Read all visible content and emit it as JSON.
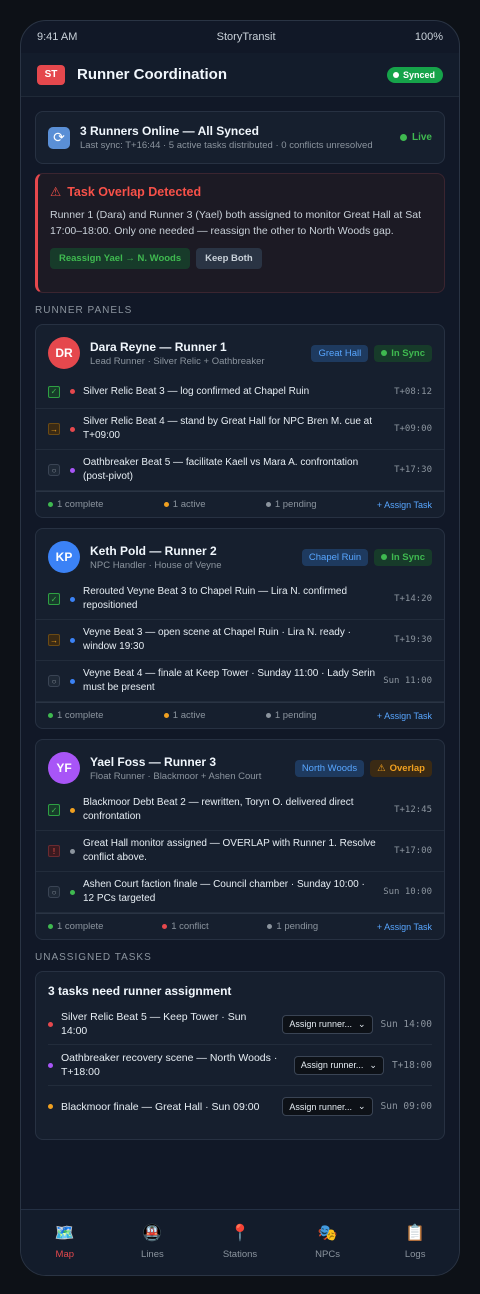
{
  "status_bar": {
    "time": "9:41 AM",
    "carrier": "StoryTransit",
    "battery": "100%"
  },
  "header": {
    "logo": "ST",
    "title": "Runner Coordination",
    "badge": "Synced"
  },
  "sync": {
    "icon": "sync-icon",
    "title": "3 Runners Online — All Synced",
    "subtitle": "Last sync: T+16:44 · 5 active tasks distributed · 0 conflicts unresolved",
    "live": "Live"
  },
  "alert": {
    "icon": "warning-icon",
    "title": "Task Overlap Detected",
    "body": "Runner 1 (Dara) and Runner 3 (Yael) both assigned to monitor Great Hall at Sat 17:00–18:00. Only one needed — reassign the other to North Woods gap.",
    "primary": "Reassign Yael → N. Woods",
    "secondary": "Keep Both"
  },
  "sections": {
    "runners": "RUNNER PANELS",
    "unassigned": "UNASSIGNED TASKS"
  },
  "colors": {
    "accent": "#e5484d",
    "green": "#3fb950",
    "amber": "#f0a020",
    "blue": "#58a6ff",
    "purple": "#a855f7",
    "gray": "#8b949e"
  },
  "runners": [
    {
      "initials": "DR",
      "avatar_color": "#e5484d",
      "name": "Dara Reyne — Runner 1",
      "role": "Lead Runner · Silver Relic + Oathbreaker",
      "location": "Great Hall",
      "state": "In Sync",
      "tasks": [
        {
          "status": "done",
          "dot": "#e5484d",
          "text": "Silver Relic Beat 3 — log confirmed at Chapel Ruin",
          "time": "T+08:12"
        },
        {
          "status": "active",
          "dot": "#e5484d",
          "text": "Silver Relic Beat 4 — stand by Great Hall for NPC Bren M. cue at T+09:00",
          "time": "T+09:00"
        },
        {
          "status": "pending",
          "dot": "#a855f7",
          "text": "Oathbreaker Beat 5 — facilitate Kaell vs Mara A. confrontation (post-pivot)",
          "time": "T+17:30"
        }
      ],
      "footer": {
        "a": "1 complete",
        "b": "1 active",
        "c": "1 pending",
        "link": "+ Assign Task"
      }
    },
    {
      "initials": "KP",
      "avatar_color": "#3b82f6",
      "name": "Keth Pold — Runner 2",
      "role": "NPC Handler · House of Veyne",
      "location": "Chapel Ruin",
      "state": "In Sync",
      "tasks": [
        {
          "status": "done",
          "dot": "#3b82f6",
          "text": "Rerouted Veyne Beat 3 to Chapel Ruin — Lira N. confirmed repositioned",
          "time": "T+14:20"
        },
        {
          "status": "active",
          "dot": "#3b82f6",
          "text": "Veyne Beat 3 — open scene at Chapel Ruin · Lira N. ready · window 19:30",
          "time": "T+19:30"
        },
        {
          "status": "pending",
          "dot": "#3b82f6",
          "text": "Veyne Beat 4 — finale at Keep Tower · Sunday 11:00 · Lady Serin must be present",
          "time": "Sun 11:00"
        }
      ],
      "footer": {
        "a": "1 complete",
        "b": "1 active",
        "c": "1 pending",
        "link": "+ Assign Task"
      }
    },
    {
      "initials": "YF",
      "avatar_color": "#a855f7",
      "name": "Yael Foss — Runner 3",
      "role": "Float Runner · Blackmoor + Ashen Court",
      "location": "North Woods",
      "state": "Overlap",
      "tasks": [
        {
          "status": "done",
          "dot": "#f0a020",
          "text": "Blackmoor Debt Beat 2 — rewritten, Toryn O. delivered direct confrontation",
          "time": "T+12:45"
        },
        {
          "status": "conflict",
          "dot": "#8b949e",
          "text": "Great Hall monitor assigned — OVERLAP with Runner 1. Resolve conflict above.",
          "time": "T+17:00"
        },
        {
          "status": "pending",
          "dot": "#3fb950",
          "text": "Ashen Court faction finale — Council chamber · Sunday 10:00 · 12 PCs targeted",
          "time": "Sun 10:00"
        }
      ],
      "footer": {
        "a": "1 complete",
        "b": "1 conflict",
        "c": "1 pending",
        "link": "+ Assign Task"
      }
    }
  ],
  "unassigned": {
    "title": "3 tasks need runner assignment",
    "select_label": "Assign runner...",
    "items": [
      {
        "dot": "#e5484d",
        "text": "Silver Relic Beat 5 — Keep Tower · Sun 14:00",
        "time": "Sun 14:00"
      },
      {
        "dot": "#a855f7",
        "text": "Oathbreaker recovery scene — North Woods · T+18:00",
        "time": "T+18:00"
      },
      {
        "dot": "#f0a020",
        "text": "Blackmoor finale — Great Hall · Sun 09:00",
        "time": "Sun 09:00"
      }
    ]
  },
  "nav": [
    {
      "icon": "map-icon",
      "glyph": "🗺️",
      "label": "Map",
      "active": true
    },
    {
      "icon": "train-icon",
      "glyph": "🚇",
      "label": "Lines",
      "active": false
    },
    {
      "icon": "pin-icon",
      "glyph": "📍",
      "label": "Stations",
      "active": false
    },
    {
      "icon": "mask-icon",
      "glyph": "🎭",
      "label": "NPCs",
      "active": false
    },
    {
      "icon": "clipboard-icon",
      "glyph": "📋",
      "label": "Logs",
      "active": false
    }
  ]
}
